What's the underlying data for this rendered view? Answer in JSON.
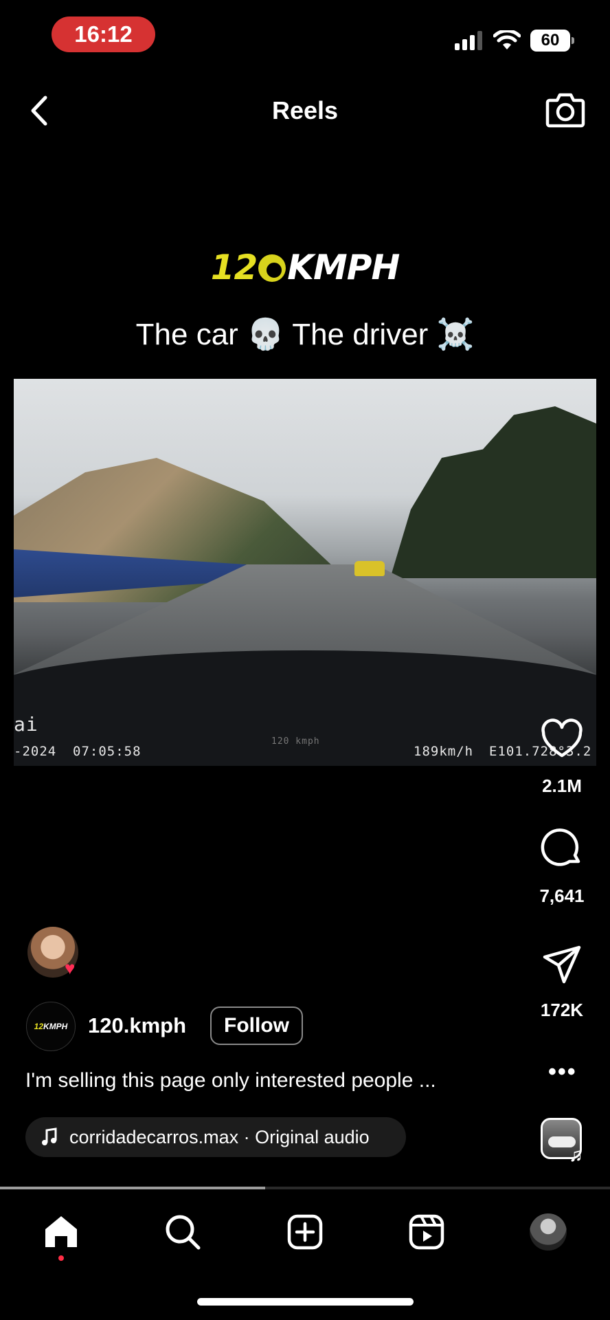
{
  "status_bar": {
    "time": "16:12",
    "battery": "60"
  },
  "header": {
    "title": "Reels"
  },
  "reel": {
    "brand_logo_number": "12",
    "brand_logo_text": "KMPH",
    "caption_overlay": "The car 💀 The driver ☠️",
    "osd": {
      "left": "ai",
      "date": "-2024",
      "time": "07:05:58",
      "center": "120 kmph",
      "speed": "189km/h",
      "coords": "E101.728°3.2"
    }
  },
  "actions": {
    "likes": "2.1M",
    "comments": "7,641",
    "shares": "172K",
    "more_label": "•••"
  },
  "account": {
    "avatar_number": "12",
    "avatar_text": "KMPH",
    "username": "120.kmph",
    "follow_label": "Follow",
    "caption": "I'm selling this page only interested people ..."
  },
  "audio": {
    "label": "corridadecarros.max · Original audio"
  },
  "playback": {
    "progress": 0.435
  },
  "colors": {
    "status_pill": "#d63232",
    "accent_red": "#ff2d55",
    "logo_yellow": "#e6e022"
  },
  "bottom_nav": [
    "home-icon",
    "search-icon",
    "create-icon",
    "reels-icon",
    "profile-avatar"
  ]
}
